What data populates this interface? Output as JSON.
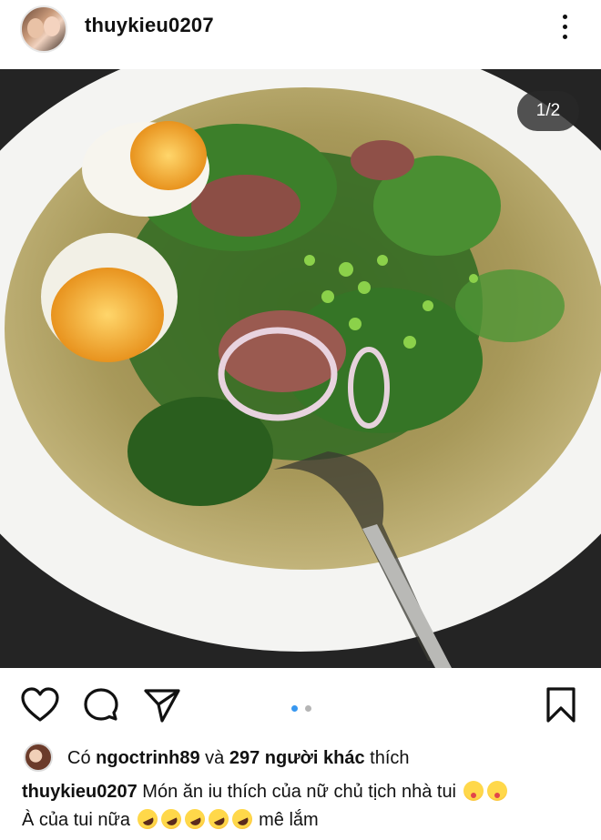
{
  "post": {
    "username": "thuykieu0207",
    "image_counter": "1/2"
  },
  "likes": {
    "prefix": "Có",
    "user": "ngoctrinh89",
    "conjunction": "và",
    "count_text": "297 người khác",
    "suffix": "thích"
  },
  "caption": {
    "author": "thuykieu0207",
    "line1": "Món ăn iu thích của nữ chủ tịch nhà tui",
    "line2_prefix": "À của tui nữa",
    "line2_suffix": "mê lắm"
  },
  "icons": {
    "like": "heart-icon",
    "comment": "comment-icon",
    "share": "send-icon",
    "save": "bookmark-icon",
    "more": "more-vertical-icon"
  },
  "colors": {
    "accent": "#3897f0",
    "inactive_dot": "#b5b5b5"
  }
}
